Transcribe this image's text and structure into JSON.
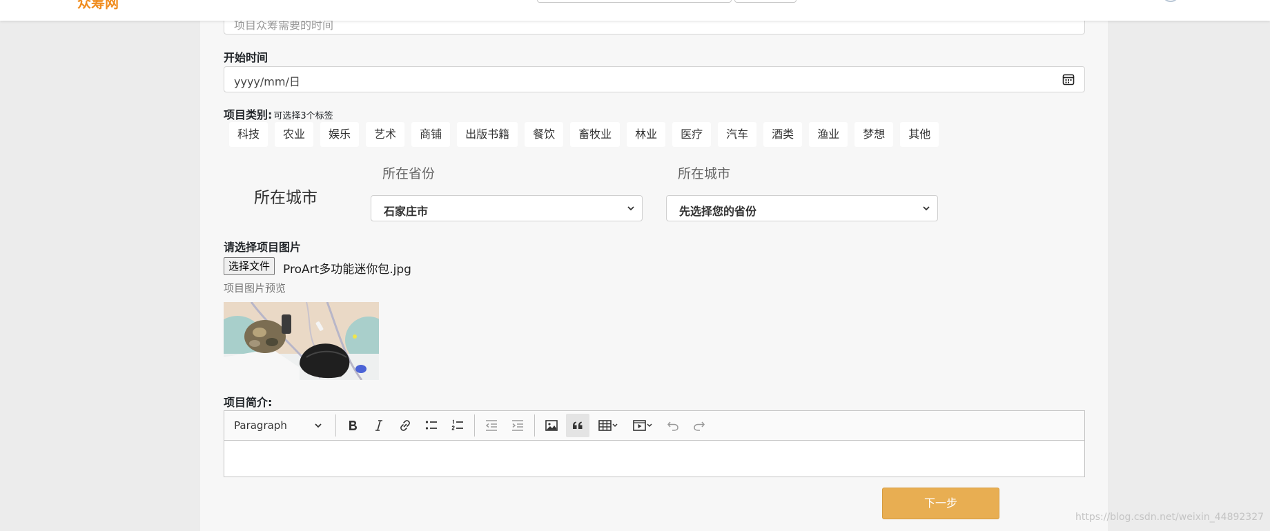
{
  "header": {
    "brand": "众筹网"
  },
  "form": {
    "duration_placeholder": "项目众筹需要的时间",
    "start_time_label": "开始时间",
    "start_time_placeholder": "yyyy/mm/日",
    "category_label": "项目类别:",
    "category_hint": "可选择3个标签",
    "categories": [
      "科技",
      "农业",
      "娱乐",
      "艺术",
      "商铺",
      "出版书籍",
      "餐饮",
      "畜牧业",
      "林业",
      "医疗",
      "汽车",
      "酒类",
      "渔业",
      "梦想",
      "其他"
    ],
    "city_section_label": "所在城市",
    "province_label": "所在省份",
    "city_label": "所在城市",
    "province_value": "石家庄市",
    "city_value": "先选择您的省份",
    "image_label": "请选择项目图片",
    "file_button": "选择文件",
    "file_name": "ProArt多功能迷你包.jpg",
    "preview_label": "项目图片预览",
    "intro_label": "项目简介:",
    "editor_heading": "Paragraph",
    "next_button": "下一步"
  },
  "watermark": "https://blog.csdn.net/weixin_44892327"
}
